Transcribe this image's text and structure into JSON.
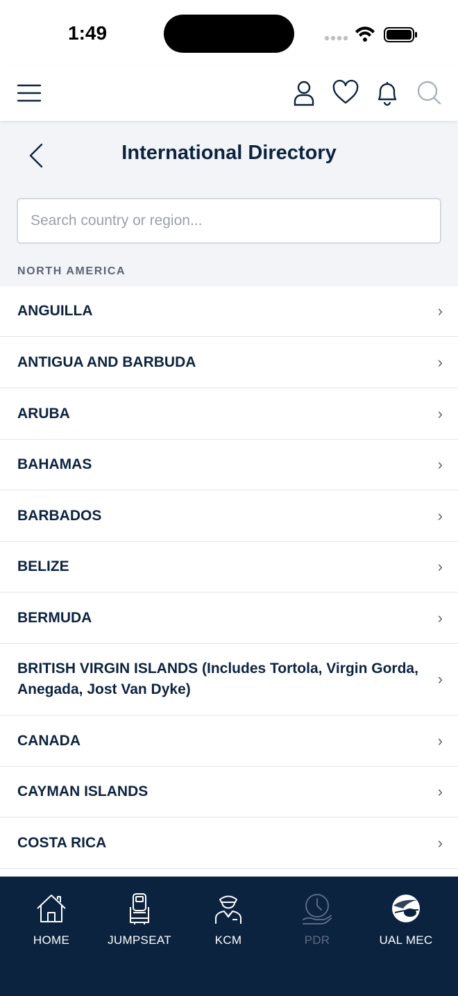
{
  "status_bar": {
    "time": "1:49"
  },
  "header": {
    "icons": [
      "menu-icon",
      "user-icon",
      "heart-icon",
      "bell-icon",
      "search-icon"
    ]
  },
  "page": {
    "title": "International Directory",
    "search_placeholder": "Search country or region...",
    "search_value": ""
  },
  "section": {
    "title": "NORTH AMERICA"
  },
  "countries": [
    "ANGUILLA",
    "ANTIGUA AND BARBUDA",
    "ARUBA",
    "BAHAMAS",
    "BARBADOS",
    "BELIZE",
    "BERMUDA",
    "BRITISH VIRGIN ISLANDS (Includes Tortola, Virgin Gorda, Anegada, Jost Van Dyke)",
    "CANADA",
    "CAYMAN ISLANDS",
    "COSTA RICA",
    ""
  ],
  "tabs": [
    {
      "label": "HOME",
      "icon": "home-icon"
    },
    {
      "label": "JUMPSEAT",
      "icon": "seat-icon"
    },
    {
      "label": "KCM",
      "icon": "pilot-icon"
    },
    {
      "label": "PDR",
      "icon": "clock-hand-icon"
    },
    {
      "label": "UAL MEC",
      "icon": "alpa-globe-icon"
    }
  ],
  "colors": {
    "navy": "#0c2340",
    "background": "#f2f4f8",
    "disabled_tab": "#5b6b82"
  }
}
